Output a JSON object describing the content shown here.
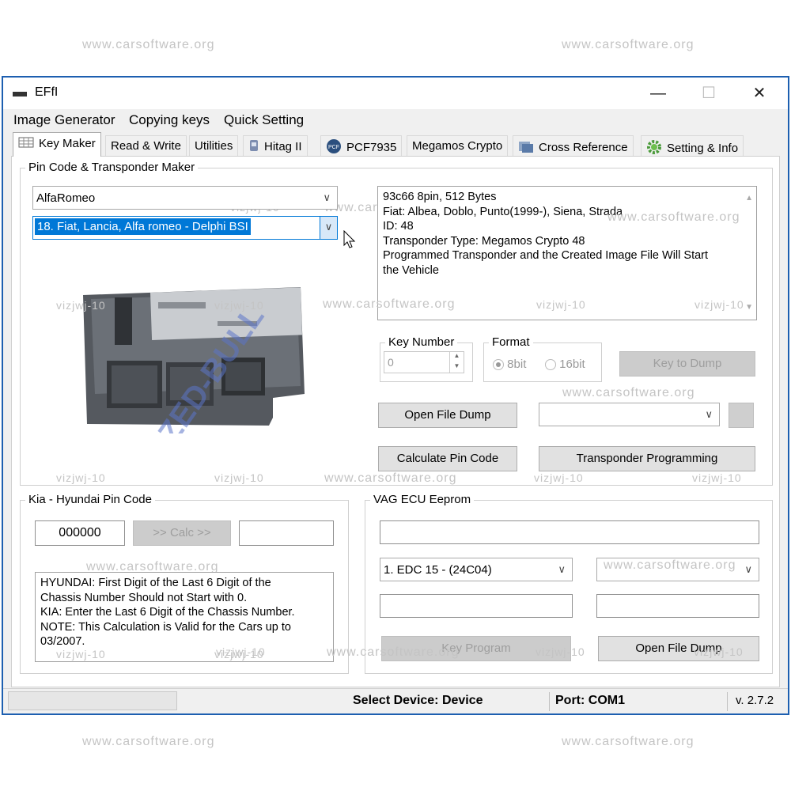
{
  "watermarks": {
    "site": "www.carsoftware.org",
    "user": "vizjwj-10"
  },
  "window": {
    "title": "EFfI",
    "minimize_icon": "—",
    "maximize_icon": "☐",
    "close_icon": "✕"
  },
  "menu": [
    "Image Generator",
    "Copying keys",
    "Quick Setting"
  ],
  "tabs": [
    "Key Maker",
    "Read & Write",
    "Utilities",
    "Hitag II",
    "PCF7935",
    "Megamos Crypto",
    "Cross Reference",
    "Setting & Info"
  ],
  "pin_code_maker": {
    "label": "Pin Code & Transponder Maker",
    "brand_value": "AlfaRomeo",
    "model_value": "18. Fiat, Lancia, Alfa romeo - Delphi BSI",
    "info_lines": [
      "93c66 8pin, 512 Bytes",
      "Fiat: Albea, Doblo, Punto(1999-), Siena, Strada",
      "ID: 48",
      "Transponder Type:  Megamos Crypto 48",
      "Programmed Transponder and the Created Image File Will Start",
      "the Vehicle"
    ],
    "image_text": "ZED-BULL",
    "key_number_label": "Key Number",
    "key_number_value": "0",
    "format_label": "Format",
    "format_8bit": "8bit",
    "format_16bit": "16bit",
    "key_to_dump": "Key to Dump",
    "open_file_dump": "Open File Dump",
    "calculate_pin_code": "Calculate Pin Code",
    "transponder_programming": "Transponder Programming"
  },
  "kia": {
    "label": "Kia - Hyundai Pin Code",
    "input_value": "000000",
    "calc_label": ">> Calc >>",
    "info_lines": [
      "HYUNDAI: First Digit of the Last 6 Digit of the",
      "Chassis Number Should not Start with 0.",
      "KIA: Enter the Last 6 Digit of the Chassis Number.",
      "NOTE: This Calculation is Valid for the Cars up to",
      "03/2007."
    ]
  },
  "vag": {
    "label": "VAG ECU Eeprom",
    "ecu_value": "1. EDC 15 - (24C04)",
    "key_program": "Key Program",
    "open_file_dump": "Open File Dump"
  },
  "status": {
    "device": "Select Device:  Device",
    "port": "Port:  COM1",
    "version": "v. 2.7.2"
  },
  "colors": {
    "title_border": "#1d5fb0",
    "selection": "#0078d7",
    "watermark": "#c4c4c4"
  }
}
